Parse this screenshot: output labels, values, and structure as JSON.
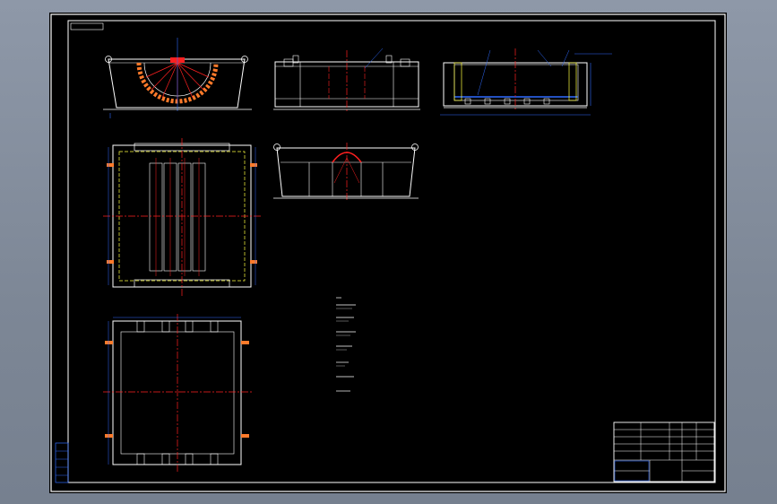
{
  "window": {
    "title": ""
  },
  "drawing": {
    "background": "#000000",
    "viewport_bg": "#7f8999",
    "colors": {
      "outline": "#ffffff",
      "center_line": "#ff2020",
      "dimension": "#2f6bff",
      "hidden": "#ffff40",
      "hatch": "#ff7a2a"
    },
    "views": [
      {
        "id": "front-view-semicircle"
      },
      {
        "id": "front-view-2"
      },
      {
        "id": "side-section-view"
      },
      {
        "id": "top-view-grate"
      },
      {
        "id": "end-view"
      },
      {
        "id": "base-frame-plan"
      }
    ],
    "notes": {
      "label_count": 8
    },
    "title_block": {
      "rows": 6
    }
  }
}
